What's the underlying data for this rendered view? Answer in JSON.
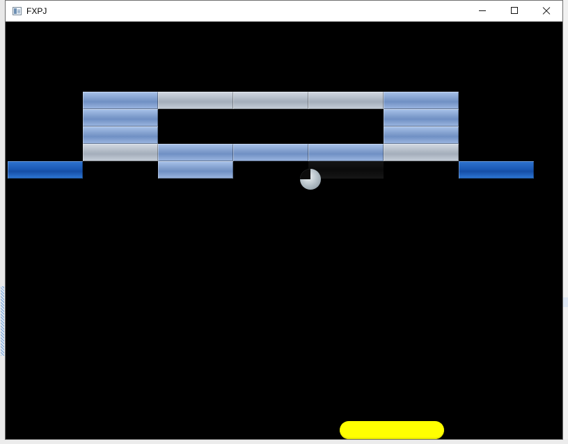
{
  "window": {
    "title": "FXPJ",
    "icon": "app-window-icon",
    "controls": {
      "minimize": "minimize-icon",
      "maximize": "maximize-icon",
      "close": "close-icon"
    }
  },
  "game": {
    "background": "#000000",
    "colors": {
      "light_blue": "#8fabd9",
      "grey": "#b9c1cc",
      "blue": "#1d5cb8",
      "paddle": "#ffff00",
      "ball": "#c0cad1"
    },
    "bricks": [
      {
        "type": "light-blue",
        "row": 0,
        "col": 1
      },
      {
        "type": "grey",
        "row": 0,
        "col": 2
      },
      {
        "type": "grey",
        "row": 0,
        "col": 3
      },
      {
        "type": "grey",
        "row": 0,
        "col": 4
      },
      {
        "type": "light-blue",
        "row": 0,
        "col": 5
      },
      {
        "type": "light-blue",
        "row": 1,
        "col": 1
      },
      {
        "type": "light-blue",
        "row": 1,
        "col": 5
      },
      {
        "type": "light-blue",
        "row": 2,
        "col": 1
      },
      {
        "type": "light-blue",
        "row": 2,
        "col": 5
      },
      {
        "type": "grey",
        "row": 3,
        "col": 1
      },
      {
        "type": "light-blue",
        "row": 3,
        "col": 2
      },
      {
        "type": "light-blue",
        "row": 3,
        "col": 3
      },
      {
        "type": "light-blue",
        "row": 3,
        "col": 4
      },
      {
        "type": "grey",
        "row": 3,
        "col": 5
      },
      {
        "type": "blue",
        "row": 4,
        "col": 0
      },
      {
        "type": "light-blue",
        "row": 4,
        "col": 2
      },
      {
        "type": "dark",
        "row": 4,
        "col": 4
      },
      {
        "type": "blue",
        "row": 4,
        "col": 6
      }
    ]
  }
}
